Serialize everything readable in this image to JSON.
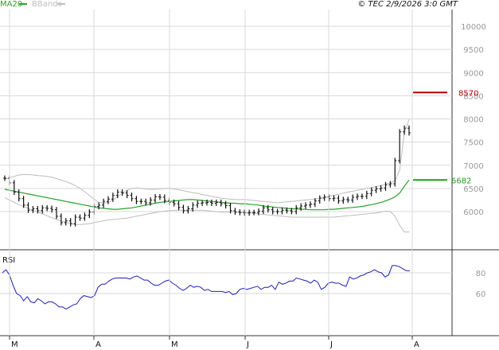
{
  "header": {
    "legend_ma": "MA20",
    "legend_bb": "BBands",
    "copyright": "© TEC 2/9/2026 3:0 GMT"
  },
  "colors": {
    "ma": "#2ca02c",
    "bbands": "#bdbdbd",
    "price": "#111111",
    "rsi": "#1f1fb4",
    "level_red": "#b40000",
    "level_green": "#1e9e1e",
    "grid": "#d9d9d9"
  },
  "chart_data": [
    {
      "type": "line",
      "name": "price-panel",
      "x_tick_labels": [
        "M",
        "A",
        "M",
        "J",
        "J",
        "A"
      ],
      "y_tick_labels": [
        "10000",
        "9500",
        "9000",
        "8500",
        "8000",
        "7500",
        "7000",
        "6500",
        "6000"
      ],
      "ylim": [
        5800,
        10300
      ],
      "grid": true,
      "series": [
        {
          "key": "ma20",
          "name": "MA20",
          "values": [
            6480,
            6460,
            6440,
            6420,
            6400,
            6380,
            6360,
            6340,
            6320,
            6300,
            6280,
            6260,
            6240,
            6220,
            6200,
            6180,
            6160,
            6140,
            6120,
            6100,
            6080,
            6070,
            6060,
            6050,
            6050,
            6060,
            6070,
            6080,
            6100,
            6120,
            6140,
            6160,
            6180,
            6200,
            6210,
            6220,
            6230,
            6240,
            6250,
            6260,
            6260,
            6250,
            6240,
            6230,
            6220,
            6210,
            6200,
            6190,
            6180,
            6180,
            6170,
            6170,
            6160,
            6150,
            6140,
            6120,
            6110,
            6100,
            6090,
            6080,
            6070,
            6060,
            6060,
            6050,
            6050,
            6040,
            6040,
            6040,
            6040,
            6050,
            6050,
            6060,
            6070,
            6080,
            6090,
            6100,
            6110,
            6130,
            6150,
            6170,
            6200,
            6230,
            6270,
            6320,
            6400,
            6550,
            6680
          ]
        },
        {
          "key": "bb_upper",
          "name": "BBands",
          "values": [
            6700,
            6730,
            6760,
            6790,
            6800,
            6800,
            6790,
            6780,
            6770,
            6760,
            6740,
            6710,
            6680,
            6650,
            6610,
            6560,
            6500,
            6430,
            6350,
            6270,
            6200,
            6180,
            6200,
            6250,
            6320,
            6400,
            6460,
            6500,
            6510,
            6500,
            6490,
            6480,
            6480,
            6490,
            6500,
            6500,
            6490,
            6470,
            6450,
            6430,
            6410,
            6390,
            6370,
            6350,
            6330,
            6310,
            6290,
            6280,
            6270,
            6260,
            6260,
            6260,
            6250,
            6240,
            6230,
            6220,
            6210,
            6200,
            6190,
            6200,
            6210,
            6220,
            6230,
            6240,
            6250,
            6260,
            6270,
            6290,
            6310,
            6330,
            6350,
            6370,
            6400,
            6420,
            6440,
            6460,
            6480,
            6500,
            6520,
            6540,
            6560,
            6590,
            6620,
            6660,
            6900,
            7700,
            7990
          ]
        },
        {
          "key": "bb_lower",
          "name": "BBands",
          "values": [
            6300,
            6250,
            6200,
            6150,
            6110,
            6070,
            6030,
            5990,
            5950,
            5910,
            5870,
            5830,
            5800,
            5770,
            5740,
            5720,
            5720,
            5730,
            5740,
            5760,
            5780,
            5800,
            5820,
            5830,
            5840,
            5850,
            5860,
            5880,
            5900,
            5920,
            5940,
            5960,
            5980,
            6000,
            6010,
            6020,
            6030,
            6030,
            6030,
            6030,
            6030,
            6030,
            6030,
            6020,
            6010,
            6000,
            5990,
            5990,
            5990,
            5990,
            5990,
            5980,
            5970,
            5960,
            5950,
            5940,
            5930,
            5920,
            5910,
            5900,
            5890,
            5880,
            5880,
            5880,
            5880,
            5880,
            5880,
            5880,
            5880,
            5880,
            5880,
            5890,
            5900,
            5910,
            5920,
            5930,
            5940,
            5950,
            5960,
            5970,
            5990,
            6010,
            6000,
            5900,
            5700,
            5560,
            5560
          ]
        },
        {
          "key": "price",
          "name": "price",
          "values": [
            6720,
            6620,
            6420,
            6280,
            6140,
            6030,
            6060,
            6020,
            6080,
            6070,
            6040,
            5900,
            5760,
            5800,
            5740,
            5880,
            5860,
            5920,
            5990,
            6110,
            6140,
            6220,
            6270,
            6350,
            6420,
            6400,
            6350,
            6280,
            6220,
            6220,
            6190,
            6250,
            6320,
            6310,
            6240,
            6200,
            6170,
            6090,
            6020,
            6060,
            6140,
            6180,
            6190,
            6200,
            6180,
            6200,
            6170,
            6130,
            6020,
            5990,
            5980,
            5970,
            5980,
            5980,
            6010,
            6080,
            6040,
            6000,
            6000,
            6030,
            6020,
            6000,
            6080,
            6120,
            6140,
            6160,
            6230,
            6290,
            6310,
            6280,
            6290,
            6230,
            6260,
            6250,
            6310,
            6330,
            6330,
            6390,
            6460,
            6490,
            6510,
            6580,
            6600,
            7100,
            7720,
            7800,
            7700
          ]
        }
      ],
      "levels": [
        {
          "value": 8570,
          "label": "8570",
          "color": "#b40000"
        },
        {
          "value": 6682,
          "label": "6682",
          "color": "#1e9e1e"
        }
      ]
    },
    {
      "type": "line",
      "name": "rsi-panel",
      "title": "RSI",
      "y_tick_labels": [
        "80",
        "60"
      ],
      "ylim": [
        44,
        100
      ],
      "grid": true,
      "series": [
        {
          "key": "rsi",
          "name": "RSI",
          "values": [
            80,
            83,
            78,
            68,
            60,
            58,
            53,
            57,
            52,
            51,
            55,
            53,
            50,
            52,
            52,
            50,
            47,
            47,
            45,
            47,
            49,
            50,
            55,
            58,
            57,
            56,
            58,
            66,
            69,
            69,
            72,
            74,
            75,
            75,
            75,
            75,
            74,
            76,
            77,
            75,
            73,
            73,
            70,
            68,
            68,
            70,
            72,
            73,
            70,
            68,
            65,
            63,
            65,
            68,
            66,
            67,
            66,
            63,
            64,
            62,
            62,
            62,
            62,
            61,
            62,
            59,
            60,
            64,
            65,
            64,
            65,
            66,
            67,
            64,
            66,
            66,
            68,
            64,
            71,
            69,
            70,
            72,
            72,
            75,
            74,
            73,
            72,
            70,
            73,
            71,
            64,
            66,
            70,
            71,
            70,
            70,
            68,
            67,
            76,
            74,
            75,
            77,
            78,
            80,
            81,
            83,
            81,
            80,
            76,
            78,
            87,
            87,
            86,
            84,
            82,
            82
          ]
        }
      ]
    }
  ]
}
